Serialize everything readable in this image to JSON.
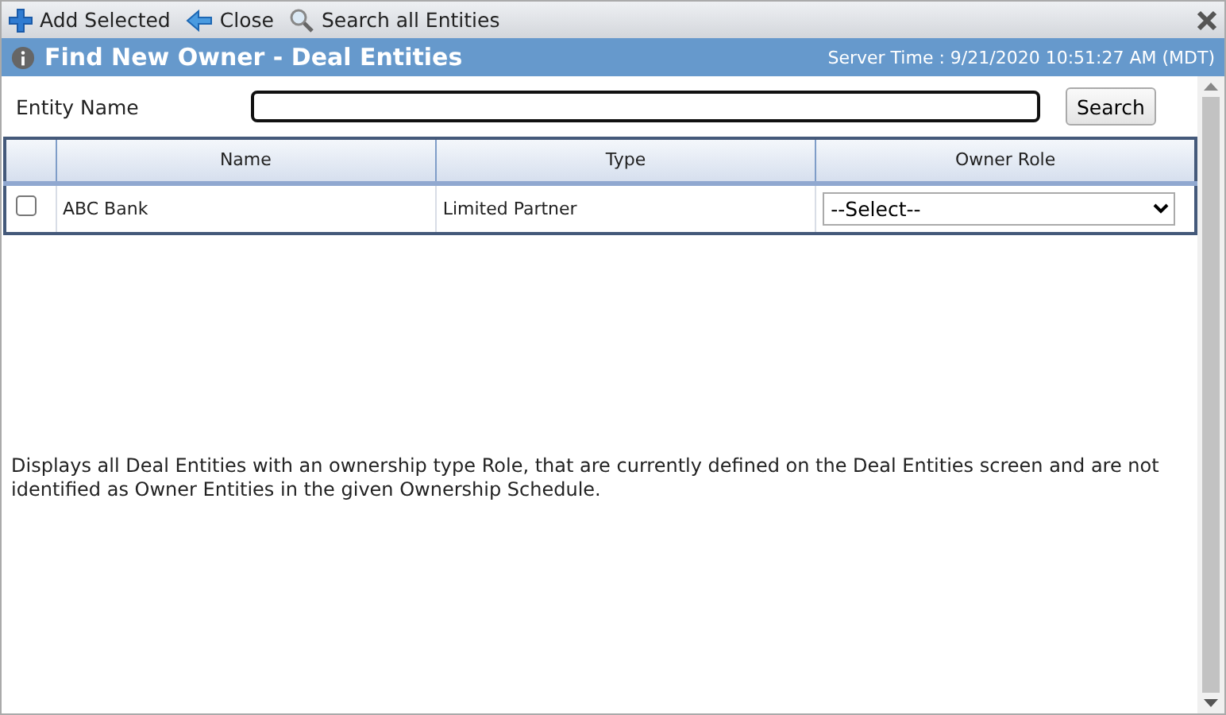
{
  "toolbar": {
    "buttons": [
      {
        "kind": "add",
        "label": "Add Selected"
      },
      {
        "kind": "back",
        "label": "Close"
      },
      {
        "kind": "search",
        "label": "Search all Entities"
      }
    ]
  },
  "window": {
    "title": "Find New Owner - Deal Entities",
    "server_time": "Server Time : 9/21/2020 10:51:27 AM (MDT)"
  },
  "search": {
    "label": "Entity Name",
    "button": "Search"
  },
  "table": {
    "columns": [
      "Name",
      "Type",
      "Owner Role"
    ],
    "rows": [
      {
        "checked": false,
        "name": "ABC Bank",
        "type": "Limited Partner",
        "owner_role": "--Select--"
      }
    ]
  },
  "description": "Displays all Deal Entities with an ownership type Role, that are currently defined on the Deal Entities screen and are not identified as Owner Entities in the given Ownership Schedule."
}
